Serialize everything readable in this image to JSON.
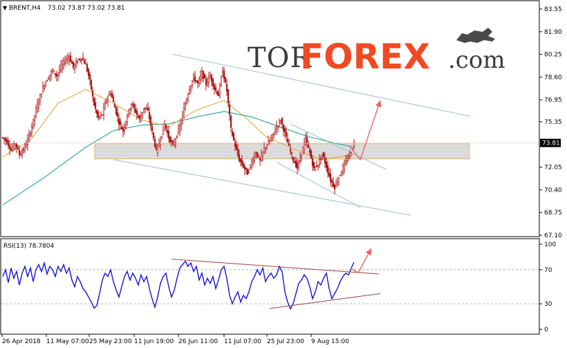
{
  "header": {
    "symbol_label": "BRENT,H4",
    "ohlc_values": "73.02 73.87 73.02 73.81"
  },
  "logo": {
    "part1": "TOR",
    "part2": "FOREX",
    "part3": ".com"
  },
  "colors": {
    "candle": "#b01414",
    "ma_slow": "#38a9a6",
    "ma_fast": "#e0a030",
    "channel_line": "#a9c4d8",
    "support_zone": "#cfcfcf",
    "arrow": "#f06060",
    "rsi_line": "#1414d4",
    "rsi_trend": "#a04040"
  },
  "chart_data": [
    {
      "type": "candlestick",
      "symbol": "BRENT",
      "timeframe": "H4",
      "last_price": "73.81",
      "ylim": [
        67.1,
        83.55
      ],
      "y_ticks": [
        "83.55",
        "81.90",
        "80.25",
        "78.60",
        "76.95",
        "75.35",
        "73.81",
        "72.05",
        "70.40",
        "68.75",
        "67.10"
      ],
      "x_ticks": [
        "26 Apr 2018",
        "11 May 07:00",
        "25 May 23:00",
        "11 Jun 19:00",
        "26 Jun 11:00",
        "11 Jul 07:00",
        "25 Jul 23:00",
        "9 Aug 15:00"
      ],
      "price_path": [
        [
          0,
          74.2
        ],
        [
          6,
          73.9
        ],
        [
          12,
          73.3
        ],
        [
          18,
          73.8
        ],
        [
          24,
          73.0
        ],
        [
          30,
          73.3
        ],
        [
          36,
          74.0
        ],
        [
          42,
          75.0
        ],
        [
          48,
          76.2
        ],
        [
          54,
          77.2
        ],
        [
          60,
          78.1
        ],
        [
          66,
          78.6
        ],
        [
          72,
          79.1
        ],
        [
          78,
          78.7
        ],
        [
          84,
          79.3
        ],
        [
          90,
          79.8
        ],
        [
          96,
          80.1
        ],
        [
          102,
          79.3
        ],
        [
          108,
          79.8
        ],
        [
          114,
          80.0
        ],
        [
          120,
          79.5
        ],
        [
          126,
          78.3
        ],
        [
          132,
          76.6
        ],
        [
          138,
          75.6
        ],
        [
          144,
          75.9
        ],
        [
          150,
          77.0
        ],
        [
          156,
          77.5
        ],
        [
          162,
          76.4
        ],
        [
          168,
          75.3
        ],
        [
          174,
          74.7
        ],
        [
          180,
          75.8
        ],
        [
          186,
          76.7
        ],
        [
          192,
          76.1
        ],
        [
          198,
          75.5
        ],
        [
          204,
          76.4
        ],
        [
          210,
          76.1
        ],
        [
          216,
          74.6
        ],
        [
          222,
          73.2
        ],
        [
          228,
          74.1
        ],
        [
          234,
          75.2
        ],
        [
          240,
          74.2
        ],
        [
          246,
          73.6
        ],
        [
          252,
          74.4
        ],
        [
          258,
          75.3
        ],
        [
          264,
          76.7
        ],
        [
          270,
          77.8
        ],
        [
          276,
          78.6
        ],
        [
          282,
          78.1
        ],
        [
          288,
          78.9
        ],
        [
          294,
          78.1
        ],
        [
          300,
          78.7
        ],
        [
          306,
          77.8
        ],
        [
          312,
          77.3
        ],
        [
          318,
          79.1
        ],
        [
          324,
          77.6
        ],
        [
          330,
          74.8
        ],
        [
          336,
          73.6
        ],
        [
          342,
          72.6
        ],
        [
          348,
          72.1
        ],
        [
          354,
          71.6
        ],
        [
          360,
          72.4
        ],
        [
          366,
          73.1
        ],
        [
          372,
          72.5
        ],
        [
          378,
          73.4
        ],
        [
          384,
          73.8
        ],
        [
          390,
          74.3
        ],
        [
          396,
          75.0
        ],
        [
          402,
          75.5
        ],
        [
          408,
          74.5
        ],
        [
          414,
          73.5
        ],
        [
          420,
          72.6
        ],
        [
          426,
          72.0
        ],
        [
          432,
          73.1
        ],
        [
          438,
          74.1
        ],
        [
          444,
          73.1
        ],
        [
          450,
          71.9
        ],
        [
          456,
          72.3
        ],
        [
          462,
          73.0
        ],
        [
          468,
          72.1
        ],
        [
          474,
          71.1
        ],
        [
          480,
          70.6
        ],
        [
          486,
          71.3
        ],
        [
          492,
          72.0
        ],
        [
          498,
          72.6
        ],
        [
          504,
          73.2
        ],
        [
          508,
          73.81
        ]
      ],
      "moving_average_slow": [
        [
          0,
          69.3
        ],
        [
          60,
          71.3
        ],
        [
          120,
          73.5
        ],
        [
          160,
          74.7
        ],
        [
          200,
          75.1
        ],
        [
          240,
          75.2
        ],
        [
          280,
          75.7
        ],
        [
          320,
          76.1
        ],
        [
          360,
          75.7
        ],
        [
          400,
          75.0
        ],
        [
          440,
          74.3
        ],
        [
          480,
          73.8
        ],
        [
          508,
          73.5
        ]
      ],
      "moving_average_fast": [
        [
          0,
          72.8
        ],
        [
          40,
          74.0
        ],
        [
          80,
          76.7
        ],
        [
          120,
          77.7
        ],
        [
          160,
          76.7
        ],
        [
          200,
          75.5
        ],
        [
          240,
          75.0
        ],
        [
          280,
          76.2
        ],
        [
          320,
          76.9
        ],
        [
          350,
          75.7
        ],
        [
          380,
          74.3
        ],
        [
          420,
          73.4
        ],
        [
          460,
          72.6
        ],
        [
          500,
          72.9
        ],
        [
          508,
          73.0
        ]
      ],
      "annotations": {
        "support_zone": [
          72.65,
          73.75
        ],
        "upper_channel": [
          [
            250,
            80.25
          ],
          [
            680,
            75.75
          ]
        ],
        "lower_channel": [
          [
            164,
            72.6
          ],
          [
            594,
            68.55
          ]
        ],
        "short_upper_line": [
          [
            420,
            75.2
          ],
          [
            558,
            71.9
          ]
        ],
        "short_lower_line": [
          [
            400,
            72.4
          ],
          [
            522,
            69.1
          ]
        ],
        "forecast_arrow": [
          [
            505,
            73.6
          ],
          [
            521,
            72.6
          ],
          [
            550,
            76.9
          ]
        ]
      }
    },
    {
      "type": "line",
      "name": "RSI(13)",
      "title": "RSI(13) 78.7804",
      "ylim": [
        0,
        100
      ],
      "y_ticks": [
        "100",
        "70",
        "30",
        "0"
      ],
      "levels": [
        70,
        30
      ],
      "values": [
        [
          0,
          62
        ],
        [
          4,
          70
        ],
        [
          8,
          55
        ],
        [
          12,
          72
        ],
        [
          16,
          60
        ],
        [
          20,
          68
        ],
        [
          24,
          52
        ],
        [
          28,
          66
        ],
        [
          32,
          74
        ],
        [
          36,
          62
        ],
        [
          40,
          72
        ],
        [
          44,
          56
        ],
        [
          48,
          70
        ],
        [
          52,
          76
        ],
        [
          56,
          68
        ],
        [
          60,
          78
        ],
        [
          64,
          65
        ],
        [
          68,
          74
        ],
        [
          72,
          70
        ],
        [
          76,
          62
        ],
        [
          80,
          74
        ],
        [
          84,
          68
        ],
        [
          88,
          76
        ],
        [
          92,
          66
        ],
        [
          96,
          72
        ],
        [
          100,
          58
        ],
        [
          104,
          50
        ],
        [
          108,
          62
        ],
        [
          112,
          56
        ],
        [
          116,
          48
        ],
        [
          120,
          44
        ],
        [
          124,
          38
        ],
        [
          128,
          32
        ],
        [
          132,
          25
        ],
        [
          136,
          28
        ],
        [
          140,
          42
        ],
        [
          144,
          58
        ],
        [
          148,
          66
        ],
        [
          152,
          62
        ],
        [
          156,
          70
        ],
        [
          160,
          56
        ],
        [
          164,
          46
        ],
        [
          168,
          38
        ],
        [
          172,
          50
        ],
        [
          176,
          62
        ],
        [
          180,
          68
        ],
        [
          184,
          58
        ],
        [
          188,
          66
        ],
        [
          192,
          60
        ],
        [
          196,
          52
        ],
        [
          200,
          64
        ],
        [
          204,
          56
        ],
        [
          208,
          62
        ],
        [
          212,
          48
        ],
        [
          216,
          36
        ],
        [
          220,
          26
        ],
        [
          224,
          38
        ],
        [
          228,
          54
        ],
        [
          232,
          62
        ],
        [
          236,
          66
        ],
        [
          240,
          50
        ],
        [
          244,
          38
        ],
        [
          248,
          46
        ],
        [
          252,
          60
        ],
        [
          256,
          72
        ],
        [
          260,
          76
        ],
        [
          264,
          80
        ],
        [
          268,
          74
        ],
        [
          272,
          78
        ],
        [
          276,
          68
        ],
        [
          280,
          74
        ],
        [
          284,
          58
        ],
        [
          288,
          66
        ],
        [
          292,
          52
        ],
        [
          296,
          60
        ],
        [
          300,
          54
        ],
        [
          304,
          62
        ],
        [
          308,
          48
        ],
        [
          312,
          58
        ],
        [
          316,
          70
        ],
        [
          320,
          74
        ],
        [
          324,
          60
        ],
        [
          328,
          40
        ],
        [
          332,
          30
        ],
        [
          336,
          38
        ],
        [
          340,
          44
        ],
        [
          344,
          32
        ],
        [
          348,
          40
        ],
        [
          352,
          36
        ],
        [
          356,
          44
        ],
        [
          360,
          56
        ],
        [
          364,
          62
        ],
        [
          368,
          70
        ],
        [
          372,
          64
        ],
        [
          376,
          72
        ],
        [
          380,
          56
        ],
        [
          384,
          62
        ],
        [
          388,
          66
        ],
        [
          392,
          60
        ],
        [
          396,
          64
        ],
        [
          400,
          74
        ],
        [
          404,
          68
        ],
        [
          408,
          44
        ],
        [
          412,
          32
        ],
        [
          416,
          24
        ],
        [
          420,
          30
        ],
        [
          424,
          42
        ],
        [
          428,
          54
        ],
        [
          432,
          58
        ],
        [
          436,
          64
        ],
        [
          440,
          60
        ],
        [
          444,
          50
        ],
        [
          448,
          36
        ],
        [
          452,
          44
        ],
        [
          456,
          56
        ],
        [
          460,
          52
        ],
        [
          464,
          60
        ],
        [
          468,
          66
        ],
        [
          472,
          48
        ],
        [
          476,
          36
        ],
        [
          480,
          42
        ],
        [
          484,
          48
        ],
        [
          488,
          56
        ],
        [
          492,
          62
        ],
        [
          496,
          66
        ],
        [
          500,
          64
        ],
        [
          504,
          72
        ],
        [
          508,
          78.78
        ]
      ],
      "annotations": {
        "upper_trendline": [
          [
            248,
            82.5
          ],
          [
            548,
            65.0
          ]
        ],
        "lower_trendline": [
          [
            390,
            24.5
          ],
          [
            550,
            42.0
          ]
        ],
        "forecast_arrow": [
          [
            507,
            72.0
          ],
          [
            518,
            66.5
          ],
          [
            537,
            95.0
          ]
        ]
      }
    }
  ]
}
